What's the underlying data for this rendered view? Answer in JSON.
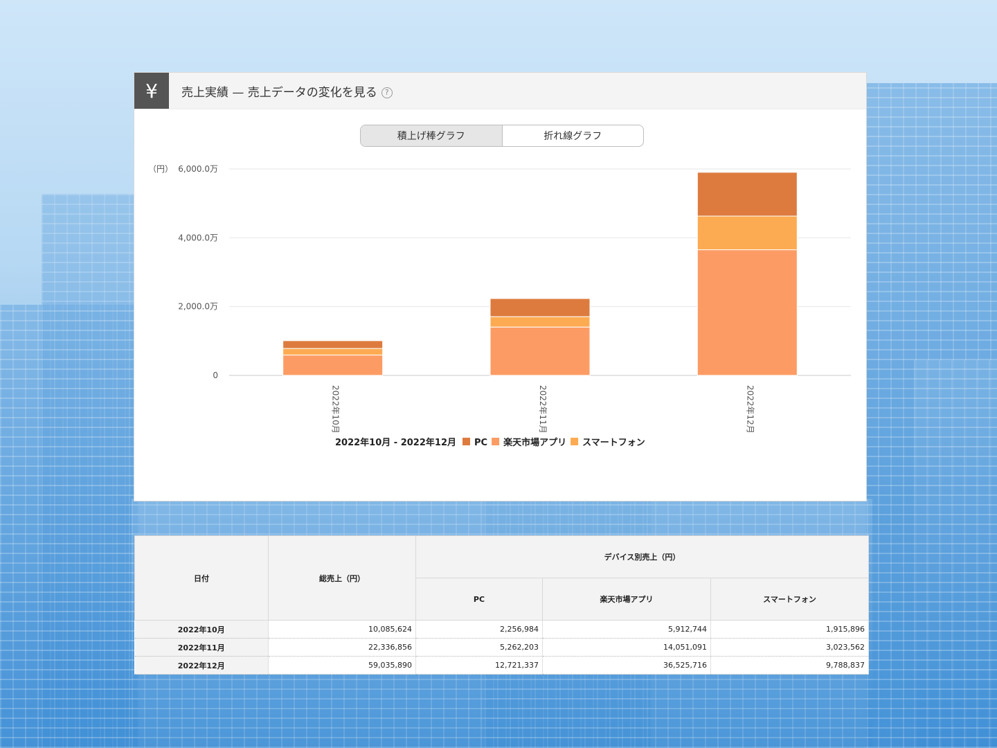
{
  "panel": {
    "icon": "yen-icon",
    "title": "売上実績 — 売上データの変化を見る",
    "help": "?"
  },
  "toggle": {
    "bar_label": "積上げ棒グラフ",
    "line_label": "折れ線グラフ"
  },
  "chart_data": {
    "type": "bar",
    "stacked": true,
    "unit_label": "（円）",
    "y_ticks": [
      "0",
      "2,000.0万",
      "4,000.0万",
      "6,000.0万"
    ],
    "ylim": [
      0,
      60000000
    ],
    "categories": [
      "2022年10月",
      "2022年11月",
      "2022年12月"
    ],
    "series": [
      {
        "name": "楽天市場アプリ",
        "color": "#fc9c64",
        "values": [
          5912744,
          14051091,
          36525716
        ]
      },
      {
        "name": "スマートフォン",
        "color": "#fdab52",
        "values": [
          1915896,
          3023562,
          9788837
        ]
      },
      {
        "name": "PC",
        "color": "#dd7b3e",
        "values": [
          2256984,
          5262203,
          12721337
        ]
      }
    ],
    "legend_period": "2022年10月 - 2022年12月",
    "legend_order": [
      "PC",
      "楽天市場アプリ",
      "スマートフォン"
    ],
    "grid": true,
    "legend_position": "bottom"
  },
  "table": {
    "col_date": "日付",
    "col_total": "総売上（円）",
    "col_device": "デバイス別売上（円）",
    "col_pc": "PC",
    "col_app": "楽天市場アプリ",
    "col_sp": "スマートフォン",
    "rows": [
      {
        "date": "2022年10月",
        "total": "10,085,624",
        "pc": "2,256,984",
        "app": "5,912,744",
        "sp": "1,915,896"
      },
      {
        "date": "2022年11月",
        "total": "22,336,856",
        "pc": "5,262,203",
        "app": "14,051,091",
        "sp": "3,023,562"
      },
      {
        "date": "2022年12月",
        "total": "59,035,890",
        "pc": "12,721,337",
        "app": "36,525,716",
        "sp": "9,788,837"
      }
    ]
  }
}
